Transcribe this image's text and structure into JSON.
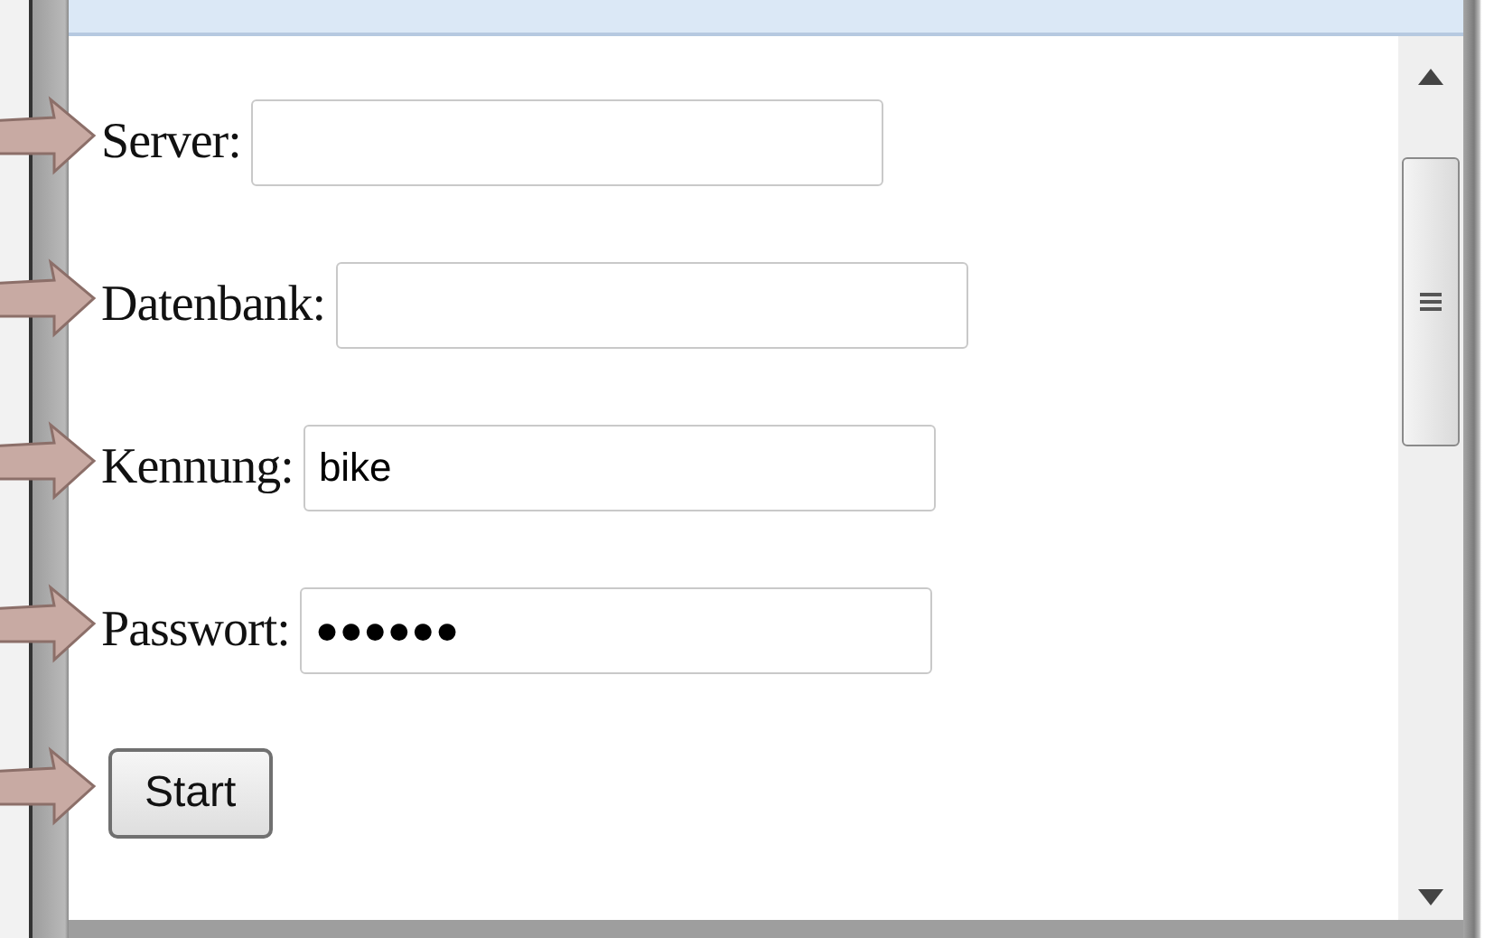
{
  "form": {
    "fields": [
      {
        "label": "Server:"
      },
      {
        "label": "Datenbank:"
      },
      {
        "label": "Kennung:",
        "value": "bike"
      },
      {
        "label": "Passwort:",
        "value": "●●●●●●"
      }
    ],
    "button": {
      "label": "Start"
    }
  }
}
